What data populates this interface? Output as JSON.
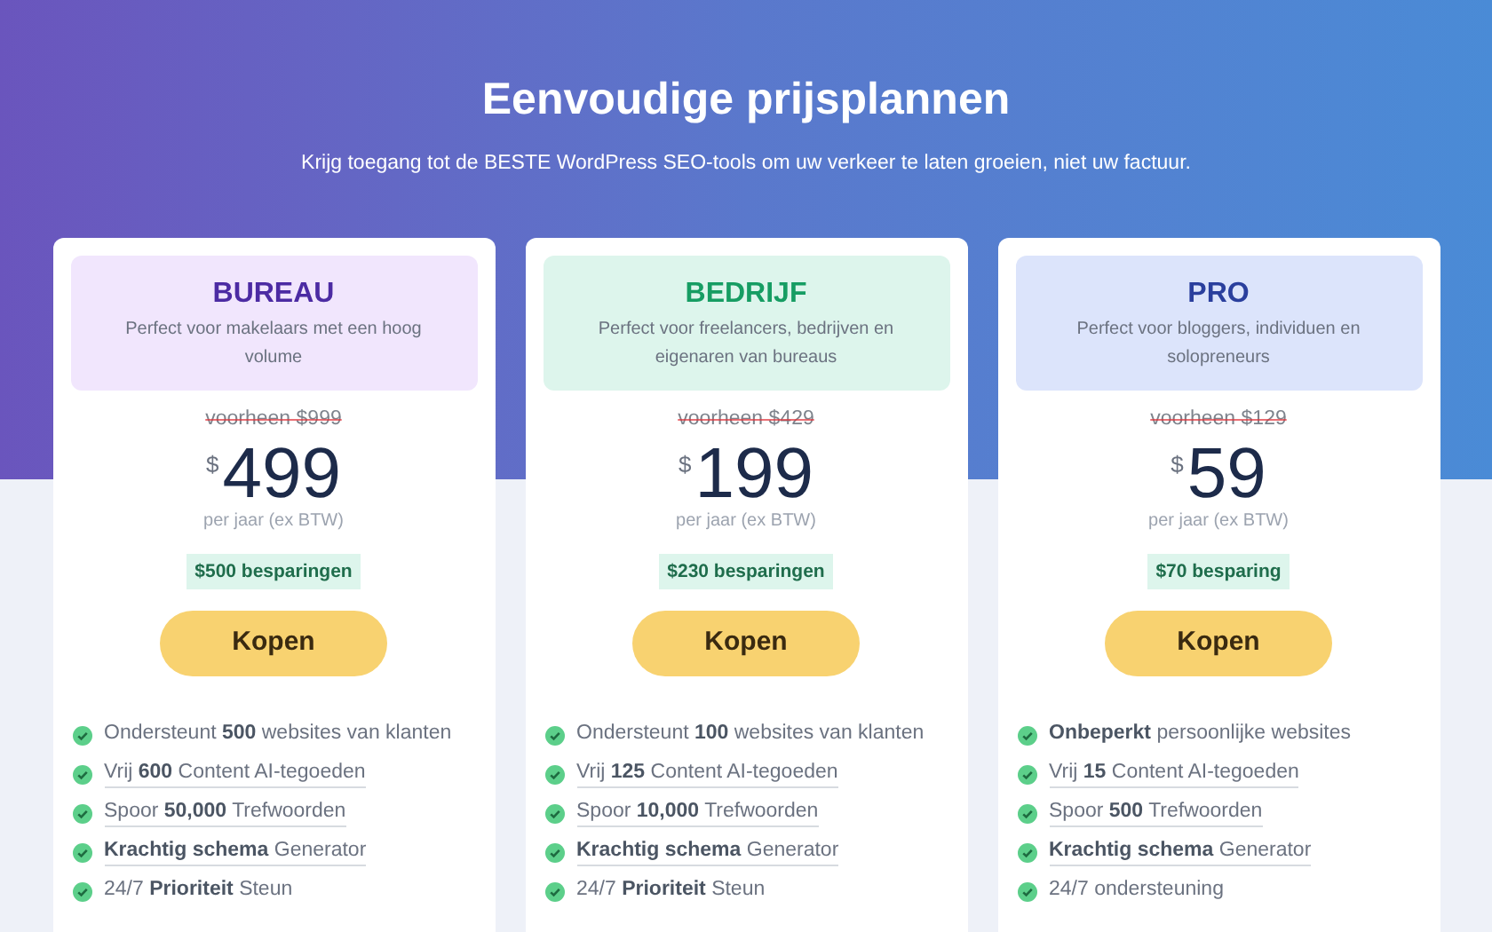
{
  "hero": {
    "title": "Eenvoudige prijsplannen",
    "subtitle": "Krijg toegang tot de BESTE WordPress SEO-tools om uw verkeer te laten groeien, niet uw factuur."
  },
  "plans": [
    {
      "kind": "purple",
      "name": "BUREAU",
      "description": "Perfect voor makelaars met een hoog volume",
      "old_price": "voorheen $999",
      "currency": "$",
      "price": "499",
      "period": "per jaar (ex BTW)",
      "savings": "$500 besparingen",
      "button": "Kopen",
      "features": [
        {
          "text": "Ondersteunt **500** websites van klanten",
          "underlined": false
        },
        {
          "text": "Vrij **600** Content AI-tegoeden",
          "underlined": true
        },
        {
          "text": "Spoor **50,000** Trefwoorden",
          "underlined": true
        },
        {
          "text": "**Krachtig schema** Generator",
          "underlined": true
        },
        {
          "text": "24/7 **Prioriteit** Steun",
          "underlined": false
        }
      ]
    },
    {
      "kind": "green",
      "name": "BEDRIJF",
      "description": "Perfect voor freelancers, bedrijven en eigenaren van bureaus",
      "old_price": "voorheen $429",
      "currency": "$",
      "price": "199",
      "period": "per jaar (ex BTW)",
      "savings": "$230 besparingen",
      "button": "Kopen",
      "features": [
        {
          "text": "Ondersteunt **100** websites van klanten",
          "underlined": false
        },
        {
          "text": "Vrij **125** Content AI-tegoeden",
          "underlined": true
        },
        {
          "text": "Spoor **10,000** Trefwoorden",
          "underlined": true
        },
        {
          "text": "**Krachtig schema** Generator",
          "underlined": true
        },
        {
          "text": "24/7 **Prioriteit** Steun",
          "underlined": false
        }
      ]
    },
    {
      "kind": "blue",
      "name": "PRO",
      "description": "Perfect voor bloggers, individuen en solopreneurs",
      "old_price": "voorheen $129",
      "currency": "$",
      "price": "59",
      "period": "per jaar (ex BTW)",
      "savings": "$70 besparing",
      "button": "Kopen",
      "features": [
        {
          "text": "**Onbeperkt** persoonlijke websites",
          "underlined": false
        },
        {
          "text": "Vrij **15** Content AI-tegoeden",
          "underlined": true
        },
        {
          "text": "Spoor **500** Trefwoorden",
          "underlined": true
        },
        {
          "text": "**Krachtig schema** Generator",
          "underlined": true
        },
        {
          "text": "24/7 ondersteuning",
          "underlined": false
        }
      ]
    }
  ]
}
